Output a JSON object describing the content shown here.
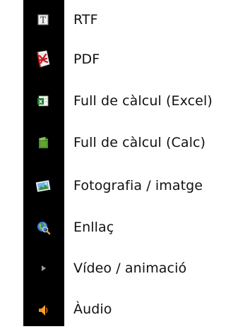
{
  "file_types": [
    {
      "label": "RTF",
      "icon": "rtf-document-icon"
    },
    {
      "label": "PDF",
      "icon": "pdf-acrobat-icon"
    },
    {
      "label": "Full de càlcul (Excel)",
      "icon": "excel-spreadsheet-icon"
    },
    {
      "label": "Full de càlcul (Calc)",
      "icon": "calc-spreadsheet-icon"
    },
    {
      "label": "Fotografia / imatge",
      "icon": "image-photo-icon"
    },
    {
      "label": "Enllaç",
      "icon": "globe-link-icon"
    },
    {
      "label": "Vídeo / animació",
      "icon": "play-video-icon"
    },
    {
      "label": "Àudio",
      "icon": "speaker-audio-icon"
    }
  ],
  "colors": {
    "icon_column_background": "#000000",
    "text": "#111111",
    "page_background": "#ffffff"
  }
}
